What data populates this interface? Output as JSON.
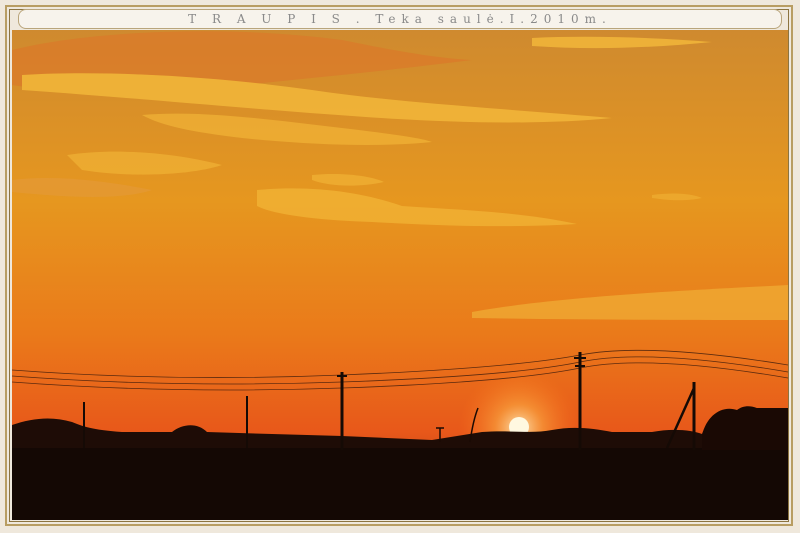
{
  "caption": {
    "text": "T R A U P I S . Teka saulė.I.2010m."
  },
  "photo": {
    "subject": "sunset-over-field-with-power-poles",
    "colors": {
      "sky_top": "#d8892a",
      "sky_mid": "#e8961d",
      "sky_horizon": "#e8551c",
      "sun": "#fff6d8",
      "clouds": "#f2b737",
      "ground": "#120803"
    }
  }
}
